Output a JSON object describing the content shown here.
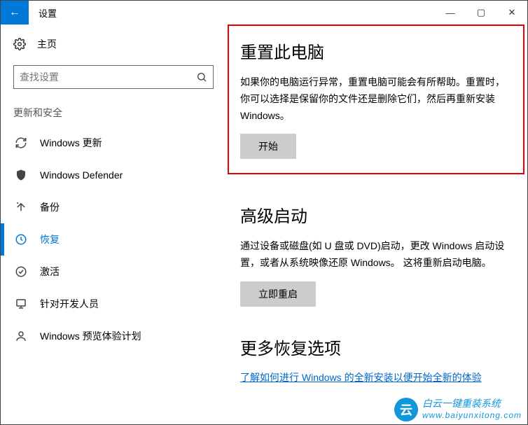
{
  "window": {
    "title": "设置",
    "back_arrow": "←",
    "minimize": "—",
    "maximize": "▢",
    "close": "✕"
  },
  "sidebar": {
    "home_label": "主页",
    "search_placeholder": "查找设置",
    "category": "更新和安全",
    "items": [
      {
        "label": "Windows 更新",
        "icon": "sync"
      },
      {
        "label": "Windows Defender",
        "icon": "shield"
      },
      {
        "label": "备份",
        "icon": "backup"
      },
      {
        "label": "恢复",
        "icon": "recovery",
        "selected": true
      },
      {
        "label": "激活",
        "icon": "check"
      },
      {
        "label": "针对开发人员",
        "icon": "dev"
      },
      {
        "label": "Windows 预览体验计划",
        "icon": "insider"
      }
    ]
  },
  "main": {
    "reset": {
      "title": "重置此电脑",
      "desc": "如果你的电脑运行异常，重置电脑可能会有所帮助。重置时，你可以选择是保留你的文件还是删除它们，然后再重新安装 Windows。",
      "button": "开始"
    },
    "advanced": {
      "title": "高级启动",
      "desc": "通过设备或磁盘(如 U 盘或 DVD)启动，更改 Windows 启动设置，或者从系统映像还原 Windows。 这将重新启动电脑。",
      "button": "立即重启"
    },
    "more": {
      "title": "更多恢复选项",
      "link": "了解如何进行 Windows 的全新安装以便开始全新的体验"
    }
  },
  "watermark": {
    "line1": "白云一键重装系统",
    "line2": "www.baiyunxitong.com"
  }
}
